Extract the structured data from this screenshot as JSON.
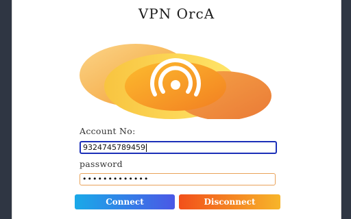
{
  "app": {
    "title": "VPN OrcA"
  },
  "logo": {
    "icon": "broadcast-icon"
  },
  "form": {
    "account_label": "Account No:",
    "account_value": "9324745789459",
    "password_label": "password",
    "password_value": "•••••••••••••"
  },
  "buttons": {
    "connect": "Connect",
    "disconnect": "Disconnect"
  },
  "colors": {
    "connect_start": "#1aa9e8",
    "connect_end": "#4a58e6",
    "disconnect_start": "#f2501a",
    "disconnect_end": "#f7b52a",
    "input_border": "#e9a259",
    "focus_border": "#1b2fb8"
  }
}
